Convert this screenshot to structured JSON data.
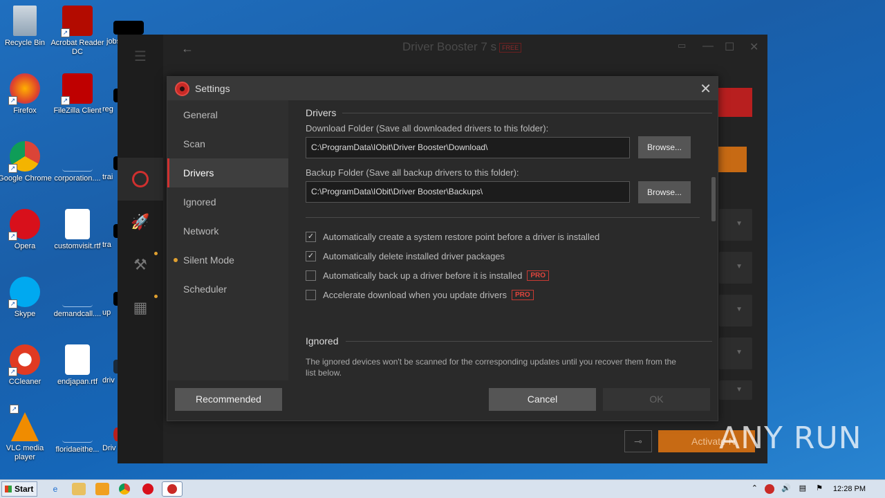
{
  "desktop": {
    "icons": [
      {
        "label": "Recycle Bin"
      },
      {
        "label": "Acrobat Reader DC"
      },
      {
        "label": "jobs"
      },
      {
        "label": "Firefox"
      },
      {
        "label": "FileZilla Client"
      },
      {
        "label": "reg"
      },
      {
        "label": "Google Chrome"
      },
      {
        "label": "corporation...."
      },
      {
        "label": "trai"
      },
      {
        "label": "Opera"
      },
      {
        "label": "customvisit.rtf"
      },
      {
        "label": "tra"
      },
      {
        "label": "Skype"
      },
      {
        "label": "demandcall...."
      },
      {
        "label": "up"
      },
      {
        "label": "CCleaner"
      },
      {
        "label": "endjapan.rtf"
      },
      {
        "label": "driv"
      },
      {
        "label": "VLC media player"
      },
      {
        "label": "floridaeithe..."
      },
      {
        "label": "Driv"
      }
    ]
  },
  "app": {
    "title": "Driver Booster 7",
    "badge": "FREE",
    "back_icon": "←",
    "menu_icon": "☰",
    "chat_icon": "💬",
    "minimize": "—",
    "maximize": "☐",
    "close": "✕",
    "activate_label": "Activate N"
  },
  "dialog": {
    "title": "Settings",
    "close": "✕",
    "nav": [
      {
        "label": "General"
      },
      {
        "label": "Scan"
      },
      {
        "label": "Drivers"
      },
      {
        "label": "Ignored"
      },
      {
        "label": "Network"
      },
      {
        "label": "Silent Mode"
      },
      {
        "label": "Scheduler"
      }
    ],
    "drivers": {
      "section_title": "Drivers",
      "download_label": "Download Folder (Save all downloaded drivers to this folder):",
      "download_path": "C:\\ProgramData\\IObit\\Driver Booster\\Download\\",
      "backup_label": "Backup Folder (Save all backup drivers to this folder):",
      "backup_path": "C:\\ProgramData\\IObit\\Driver Booster\\Backups\\",
      "browse_label": "Browse...",
      "options": [
        {
          "label": "Automatically create a system restore point before a driver is installed",
          "checked": true,
          "pro": ""
        },
        {
          "label": "Automatically delete installed driver packages",
          "checked": true,
          "pro": ""
        },
        {
          "label": "Automatically back up a driver before it is installed",
          "checked": false,
          "pro": "PRO"
        },
        {
          "label": "Accelerate download when you update drivers",
          "checked": false,
          "pro": "PRO"
        }
      ]
    },
    "ignored": {
      "section_title": "Ignored",
      "description": "The ignored devices won't be scanned for the corresponding updates until you recover them from the list below."
    },
    "footer": {
      "recommended": "Recommended",
      "cancel": "Cancel",
      "ok": "OK"
    }
  },
  "taskbar": {
    "start_label": "Start",
    "clock": "12:28 PM"
  },
  "watermark": "ANY RUN",
  "colors": {
    "accent_red": "#d0302f",
    "pro_red": "#e0453d",
    "pending_dot": "#e0a030"
  }
}
